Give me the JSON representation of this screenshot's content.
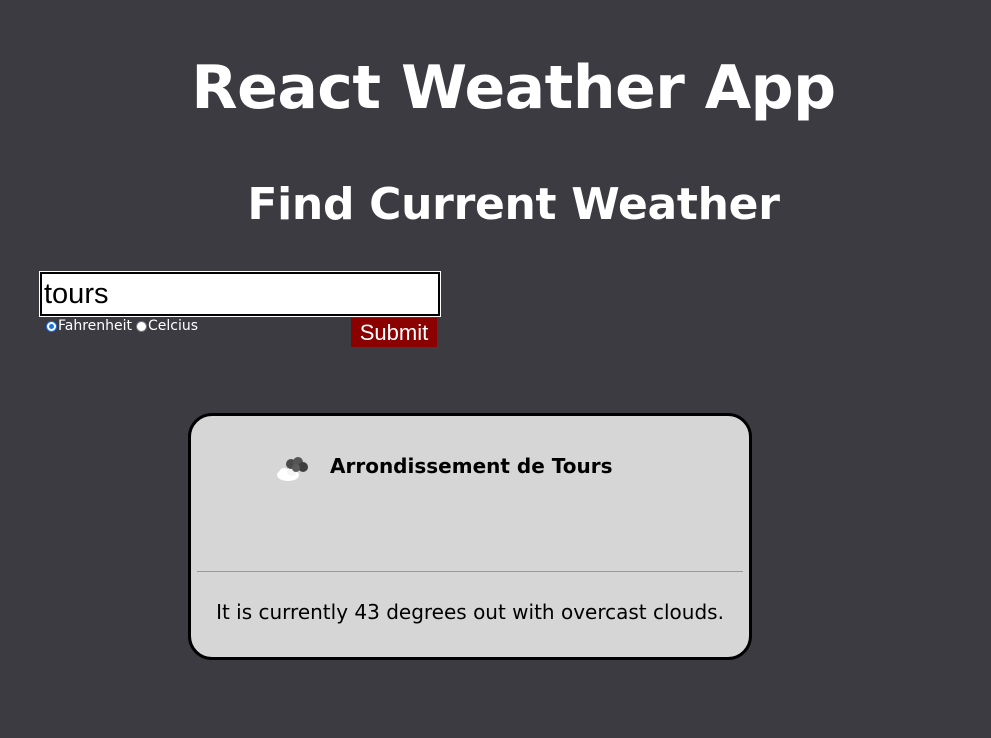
{
  "header": {
    "title": "React Weather App",
    "subtitle": "Find Current Weather"
  },
  "search": {
    "value": "tours"
  },
  "units": {
    "options": [
      {
        "label": "Fahrenheit",
        "selected": true
      },
      {
        "label": "Celcius",
        "selected": false
      }
    ]
  },
  "form": {
    "submit_label": "Submit"
  },
  "weather": {
    "city": "Arrondissement de Tours",
    "icon": "overcast-clouds-icon",
    "description": "It is currently 43 degrees out with overcast clouds."
  },
  "colors": {
    "background": "#3c3b41",
    "submit": "#8b0000",
    "card": "#d6d6d6"
  }
}
